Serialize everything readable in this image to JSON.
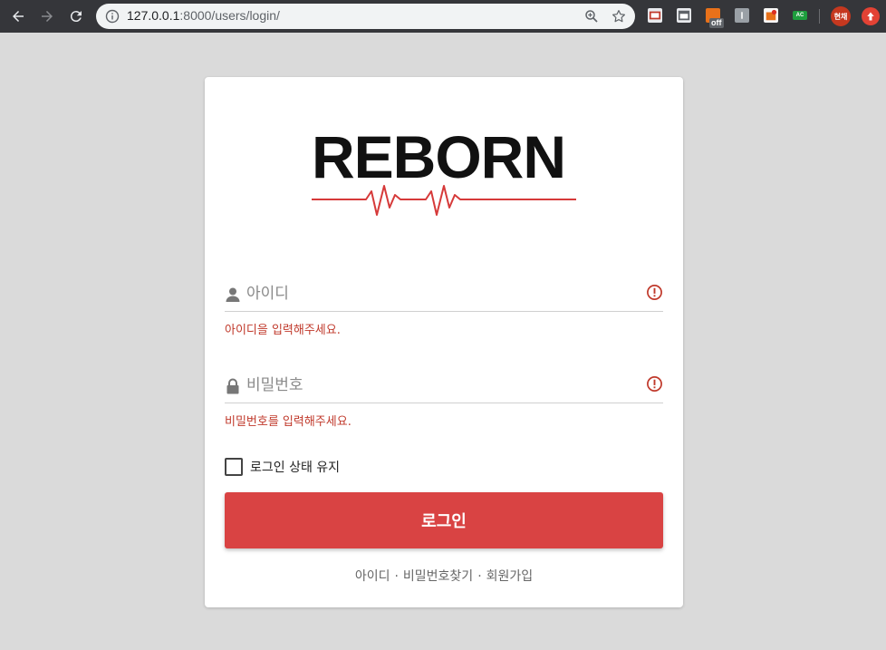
{
  "browser": {
    "url_host": "127.0.0.1",
    "url_rest": ":8000/users/login/",
    "extension_badge": "off",
    "extension_ac_label": "AC",
    "profile_label": "현채"
  },
  "logo": {
    "text": "REBORN"
  },
  "username": {
    "placeholder": "아이디",
    "error": "아이디을 입력해주세요."
  },
  "password": {
    "placeholder": "비밀번호",
    "error": "비밀번호를 입력해주세요."
  },
  "remember": {
    "label": "로그인 상태 유지",
    "checked": false
  },
  "login_button": {
    "label": "로그인"
  },
  "links": {
    "find_id": "아이디",
    "find_password": "비밀번호찾기",
    "signup": "회원가입",
    "separator": "·"
  },
  "colors": {
    "accent": "#d94343",
    "error": "#c0392b",
    "background": "#dadada"
  }
}
